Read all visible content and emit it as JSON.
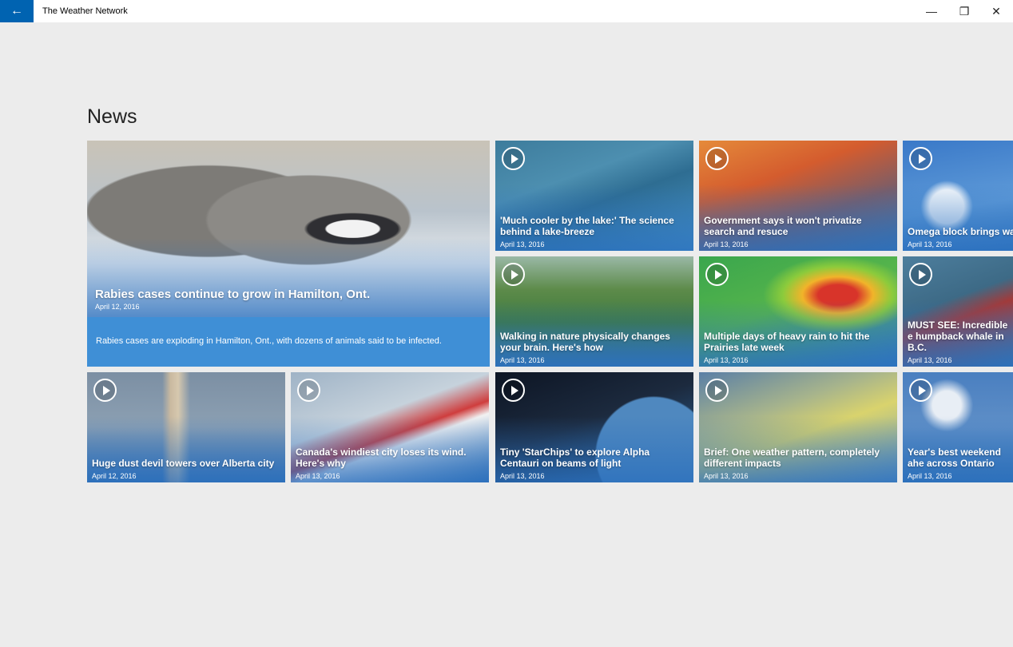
{
  "window": {
    "title": "The Weather Network",
    "back_label": "←",
    "minimize_label": "—",
    "maximize_label": "❐",
    "close_label": "✕"
  },
  "page": {
    "title": "News"
  },
  "featured": {
    "headline": "Rabies cases continue to grow in Hamilton, Ont.",
    "date": "April 12, 2016",
    "summary": "Rabies cases are exploding in Hamilton, Ont., with dozens of animals said to be infected."
  },
  "tiles": [
    {
      "headline": "'Much cooler by the lake:' The science behind a lake-breeze",
      "date": "April 13, 2016",
      "video": true
    },
    {
      "headline": "Government says it won't privatize search and resuce",
      "date": "April 13, 2016",
      "video": true
    },
    {
      "headline": "Omega block brings war to parts of Ontario",
      "date": "April 13, 2016",
      "video": true
    },
    {
      "headline": "Walking in nature physically changes your brain. Here's how",
      "date": "April 13, 2016",
      "video": true
    },
    {
      "headline": "Multiple days of heavy rain to hit the Prairies late week",
      "date": "April 13, 2016",
      "video": true
    },
    {
      "headline": "MUST SEE: Incredible e humpback whale in B.C.",
      "date": "April 13, 2016",
      "video": true
    },
    {
      "headline": "Huge dust devil towers over Alberta city",
      "date": "April 12, 2016",
      "video": true
    },
    {
      "headline": "Canada's windiest city loses its wind. Here's why",
      "date": "April 13, 2016",
      "video": true
    },
    {
      "headline": "Tiny 'StarChips' to explore Alpha Centauri on beams of light",
      "date": "April 13, 2016",
      "video": true
    },
    {
      "headline": "Brief: One weather pattern, completely different impacts",
      "date": "April 13, 2016",
      "video": true
    },
    {
      "headline": "Year's best weekend ahe across Ontario",
      "date": "April 13, 2016",
      "video": true
    }
  ],
  "colors": {
    "accent": "#0063b1",
    "summary_background": "#3f8fd6",
    "page_background": "#ececec"
  },
  "icons": {
    "back": "back-arrow-icon",
    "play": "play-icon"
  }
}
